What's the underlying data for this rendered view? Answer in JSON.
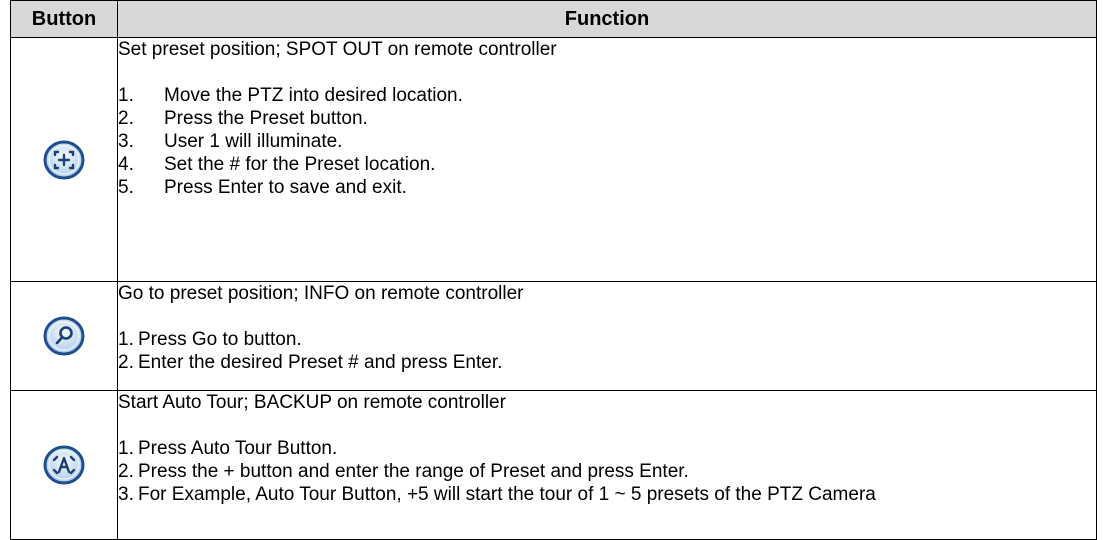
{
  "table": {
    "headers": {
      "button": "Button",
      "function": "Function"
    },
    "rows": [
      {
        "icon": "preset-set-icon",
        "description": "Set preset position; SPOT OUT on remote controller",
        "steps": [
          {
            "num": "1.",
            "text": "Move the PTZ into desired location."
          },
          {
            "num": "2.",
            "text": "Press the Preset button."
          },
          {
            "num": "3.",
            "text": "User 1 will illuminate."
          },
          {
            "num": "4.",
            "text": "Set the # for the Preset location."
          },
          {
            "num": "5.",
            "text": "Press Enter to save and exit."
          }
        ]
      },
      {
        "icon": "preset-goto-icon",
        "description": "Go to preset position; INFO on remote controller",
        "steps": [
          {
            "num": "1.",
            "text": "Press Go to button."
          },
          {
            "num": "2.",
            "text": "Enter the desired Preset # and press Enter."
          }
        ]
      },
      {
        "icon": "auto-tour-icon",
        "description": "Start Auto Tour; BACKUP on remote controller",
        "steps": [
          {
            "num": "1.",
            "text": "Press Auto Tour Button."
          },
          {
            "num": "2.",
            "text": "Press the + button and enter the range of Preset and press Enter."
          },
          {
            "num": "3.",
            "text": "For Example, Auto Tour Button, +5 will start the tour of 1 ~ 5 presets of the PTZ Camera"
          }
        ]
      }
    ]
  },
  "colors": {
    "header_bg": "#d8d8d8",
    "icon_ring": "#1f4e8c",
    "icon_fill": "#cfe3f3"
  }
}
